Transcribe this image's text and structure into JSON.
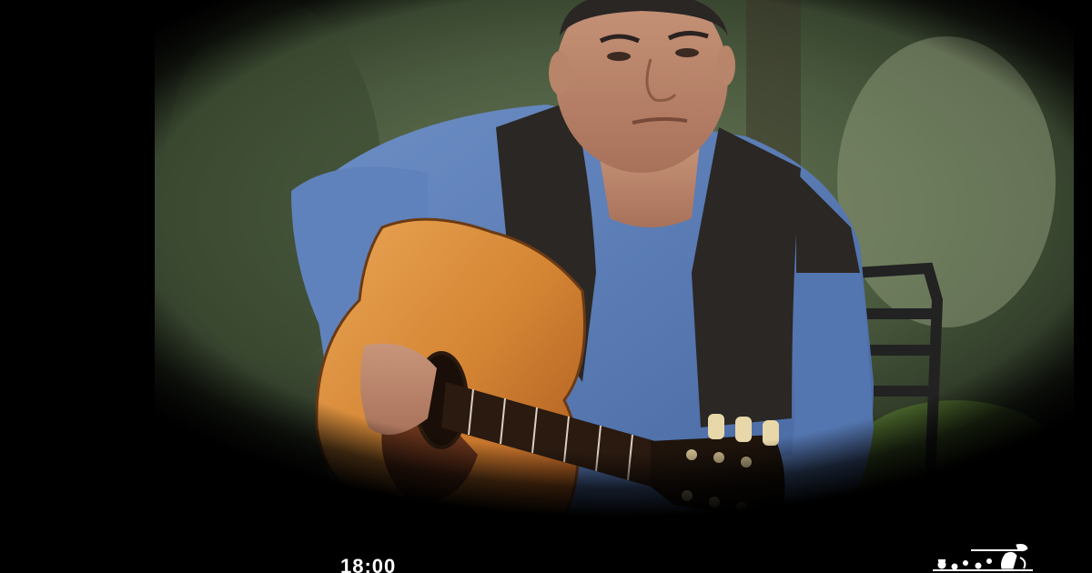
{
  "photo": {
    "subject": "man-playing-acoustic-guitar",
    "vignette_color": "#000000",
    "background_tint": "#3d4a33",
    "shirt_color": "#5b7fb8",
    "vest_color": "#2a2624",
    "guitar_color": "#d08a3a"
  },
  "overlay": {
    "time": "18:00"
  },
  "logo": {
    "icon": "channel-logo-icon",
    "color": "#ffffff"
  }
}
